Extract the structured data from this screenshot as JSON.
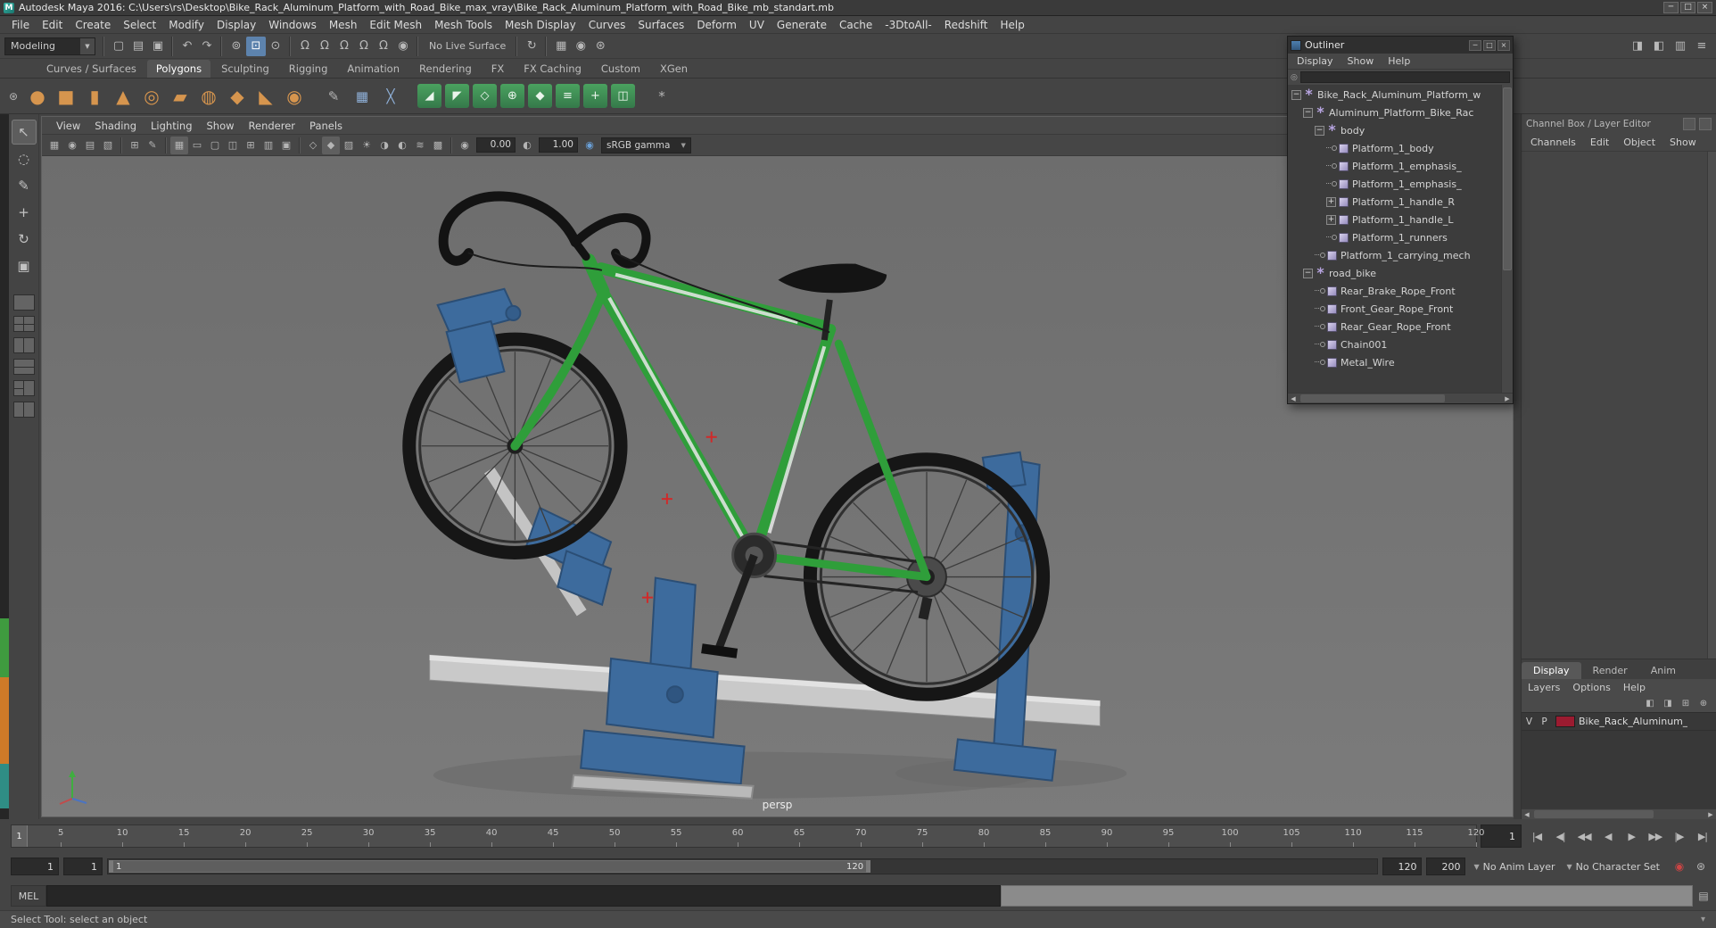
{
  "titlebar": {
    "title": "Autodesk Maya 2016: C:\\Users\\rs\\Desktop\\Bike_Rack_Aluminum_Platform_with_Road_Bike_max_vray\\Bike_Rack_Aluminum_Platform_with_Road_Bike_mb_standart.mb",
    "app_icon_letter": "M",
    "controls": [
      {
        "name": "minimize-button",
        "g": "─"
      },
      {
        "name": "maximize-button",
        "g": "□"
      },
      {
        "name": "close-button",
        "g": "×"
      }
    ]
  },
  "menubar": {
    "items": [
      "File",
      "Edit",
      "Create",
      "Select",
      "Modify",
      "Display",
      "Windows",
      "Mesh",
      "Edit Mesh",
      "Mesh Tools",
      "Mesh Display",
      "Curves",
      "Surfaces",
      "Deform",
      "UV",
      "Generate",
      "Cache",
      "-3DtoAll-",
      "Redshift",
      "Help"
    ]
  },
  "statusline": {
    "mode_selector": "Modeling",
    "items": [
      {
        "sep": true
      },
      {
        "icon": "new-scene-icon",
        "g": "▢"
      },
      {
        "icon": "open-scene-icon",
        "g": "▤"
      },
      {
        "icon": "save-scene-icon",
        "g": "▣"
      },
      {
        "sep": true
      },
      {
        "icon": "undo-icon",
        "g": "↶"
      },
      {
        "icon": "redo-icon",
        "g": "↷"
      },
      {
        "sep": true
      },
      {
        "icon": "select-by-hierarchy-icon",
        "g": "⊚"
      },
      {
        "icon": "select-by-object-icon",
        "g": "⊡",
        "active": true
      },
      {
        "icon": "select-by-component-icon",
        "g": "⊙"
      },
      {
        "sep": true
      },
      {
        "icon": "snap-to-grid-icon",
        "g": "Ω"
      },
      {
        "icon": "snap-to-curve-icon",
        "g": "Ω"
      },
      {
        "icon": "snap-to-point-icon",
        "g": "Ω"
      },
      {
        "icon": "snap-to-projected-center-icon",
        "g": "Ω"
      },
      {
        "icon": "snap-to-view-plane-icon",
        "g": "Ω"
      },
      {
        "icon": "make-live-icon",
        "g": "◉"
      },
      {
        "sep": true
      },
      {
        "label": "No Live Surface"
      },
      {
        "sep": true
      },
      {
        "icon": "construction-history-icon",
        "g": "↻"
      },
      {
        "sep": true
      },
      {
        "icon": "render-icon",
        "g": "▦"
      },
      {
        "icon": "ipr-render-icon",
        "g": "◉"
      },
      {
        "icon": "render-settings-icon",
        "g": "⊛"
      }
    ],
    "right_icons": [
      {
        "icon": "toggle-attribute-editor-icon",
        "g": "◨"
      },
      {
        "icon": "toggle-tool-settings-icon",
        "g": "◧"
      },
      {
        "icon": "toggle-channel-box-icon",
        "g": "▥"
      },
      {
        "icon": "workspace-icon",
        "g": "≡"
      }
    ]
  },
  "shelf": {
    "active_tab": "Polygons",
    "tabs": [
      "Curves / Surfaces",
      "Polygons",
      "Sculpting",
      "Rigging",
      "Animation",
      "Rendering",
      "FX",
      "FX Caching",
      "Custom",
      "XGen"
    ],
    "icons": [
      {
        "icon": "shelf-menu-icon",
        "g": "⊛",
        "style": "gray",
        "small": true
      },
      {
        "icon": "poly-sphere-icon",
        "g": "●",
        "style": "orange"
      },
      {
        "icon": "poly-cube-icon",
        "g": "■",
        "style": "orange"
      },
      {
        "icon": "poly-cylinder-icon",
        "g": "▮",
        "style": "orange"
      },
      {
        "icon": "poly-cone-icon",
        "g": "▲",
        "style": "orange"
      },
      {
        "icon": "poly-torus-icon",
        "g": "◎",
        "style": "orange"
      },
      {
        "icon": "poly-plane-icon",
        "g": "▰",
        "style": "orange"
      },
      {
        "icon": "poly-disc-icon",
        "g": "◍",
        "style": "orange"
      },
      {
        "icon": "poly-platonic-icon",
        "g": "◆",
        "style": "orange"
      },
      {
        "icon": "poly-pyramid-icon",
        "g": "◣",
        "style": "orange"
      },
      {
        "icon": "poly-helix-icon",
        "g": "◉",
        "style": "orange"
      },
      {
        "sep": true
      },
      {
        "icon": "pencil-curve-icon",
        "g": "✎",
        "style": "gray"
      },
      {
        "icon": "quad-draw-icon",
        "g": "▦",
        "style": "blue"
      },
      {
        "icon": "multi-cut-icon",
        "g": "╳",
        "style": "blue"
      },
      {
        "sep": true
      },
      {
        "icon": "combine-icon",
        "g": "◢",
        "style": "green"
      },
      {
        "icon": "separate-icon",
        "g": "◤",
        "style": "green"
      },
      {
        "icon": "smooth-icon",
        "g": "◇",
        "style": "green"
      },
      {
        "icon": "extrude-icon",
        "g": "⊕",
        "style": "green"
      },
      {
        "icon": "bevel-icon",
        "g": "◆",
        "style": "green"
      },
      {
        "icon": "bridge-icon",
        "g": "≡",
        "style": "green"
      },
      {
        "icon": "merge-icon",
        "g": "+",
        "style": "green"
      },
      {
        "icon": "mirror-icon",
        "g": "◫",
        "style": "green"
      },
      {
        "sep": true
      },
      {
        "icon": "sculpt-icon",
        "g": "*",
        "style": "gray"
      }
    ]
  },
  "toolbox": {
    "tools": [
      {
        "name": "select-tool",
        "g": "↖",
        "active": true
      },
      {
        "name": "lasso-tool",
        "g": "◌"
      },
      {
        "name": "paint-select-tool",
        "g": "✎"
      },
      {
        "name": "move-tool",
        "g": "+"
      },
      {
        "name": "rotate-tool",
        "g": "↻"
      },
      {
        "name": "scale-tool",
        "g": "▣"
      }
    ],
    "layouts": [
      {
        "name": "single-pane-layout",
        "pattern": "single"
      },
      {
        "name": "four-pane-layout",
        "pattern": "four"
      },
      {
        "name": "two-pane-side-layout",
        "pattern": "two-v"
      },
      {
        "name": "two-pane-stacked-layout",
        "pattern": "two-h"
      },
      {
        "name": "three-pane-layout",
        "pattern": "three"
      },
      {
        "name": "outliner-persp-layout",
        "pattern": "two-v"
      }
    ]
  },
  "viewport": {
    "menus": [
      "View",
      "Shading",
      "Lighting",
      "Show",
      "Renderer",
      "Panels"
    ],
    "items": [
      {
        "icon": "select-camera-icon",
        "g": "▦"
      },
      {
        "icon": "camera-attributes-icon",
        "g": "◉"
      },
      {
        "icon": "camera-bookmarks-icon",
        "g": "▤"
      },
      {
        "icon": "image-plane-icon",
        "g": "▧"
      },
      {
        "sep": true
      },
      {
        "icon": "2d-pan-zoom-icon",
        "g": "⊞"
      },
      {
        "icon": "grease-pencil-icon",
        "g": "✎"
      },
      {
        "sep": true
      },
      {
        "icon": "grid-icon",
        "g": "▦",
        "active": true
      },
      {
        "icon": "film-gate-icon",
        "g": "▭"
      },
      {
        "icon": "resolution-gate-icon",
        "g": "▢"
      },
      {
        "icon": "gate-mask-icon",
        "g": "◫"
      },
      {
        "icon": "field-chart-icon",
        "g": "⊞"
      },
      {
        "icon": "safe-action-icon",
        "g": "▥"
      },
      {
        "icon": "safe-title-icon",
        "g": "▣"
      },
      {
        "sep": true
      },
      {
        "icon": "wireframe-icon",
        "g": "◇"
      },
      {
        "icon": "smooth-shade-icon",
        "g": "◆",
        "active": true
      },
      {
        "icon": "textured-icon",
        "g": "▨"
      },
      {
        "icon": "use-all-lights-icon",
        "g": "☀"
      },
      {
        "icon": "shadows-icon",
        "g": "◑"
      },
      {
        "icon": "screen-space-ao-icon",
        "g": "◐"
      },
      {
        "icon": "motion-blur-icon",
        "g": "≋"
      },
      {
        "icon": "anti-alias-icon",
        "g": "▩"
      },
      {
        "sep": true
      },
      {
        "icon": "exposure-icon",
        "g": "◉"
      },
      {
        "field": "0.00",
        "name": "exposure-field"
      },
      {
        "icon": "gamma-icon",
        "g": "◐"
      },
      {
        "field": "1.00",
        "name": "gamma-field"
      },
      {
        "icon": "color-management-icon",
        "g": "◉",
        "color": "#6aa0d8"
      },
      {
        "dropdown": "sRGB gamma",
        "name": "view-transform-select"
      }
    ]
  },
  "scene": {
    "camera_label": "persp",
    "colors": {
      "viewport_top": "#6d6d6d",
      "viewport_bottom": "#7b7b7b",
      "bike_frame_green": "#2f9e3a",
      "bike_accent_white": "#e8e8e8",
      "rack_blue": "#3d6b9d",
      "rail_silver": "#c9c9c9",
      "tire_black": "#161616",
      "marker_red": "#d02a2a"
    }
  },
  "outliner": {
    "title": "Outliner",
    "menus": [
      "Display",
      "Show",
      "Help"
    ],
    "tree": [
      {
        "label": "Bike_Rack_Aluminum_Platform_w",
        "depth": 0,
        "icon": "star",
        "exp": "minus"
      },
      {
        "label": "Aluminum_Platform_Bike_Rac",
        "depth": 1,
        "icon": "star",
        "exp": "minus"
      },
      {
        "label": "body",
        "depth": 2,
        "icon": "star",
        "exp": "minus"
      },
      {
        "label": "Platform_1_body",
        "depth": 3,
        "icon": "mesh",
        "exp": "leaf"
      },
      {
        "label": "Platform_1_emphasis_",
        "depth": 3,
        "icon": "mesh",
        "exp": "leaf"
      },
      {
        "label": "Platform_1_emphasis_",
        "depth": 3,
        "icon": "mesh",
        "exp": "leaf"
      },
      {
        "label": "Platform_1_handle_R",
        "depth": 3,
        "icon": "mesh",
        "exp": "plus"
      },
      {
        "label": "Platform_1_handle_L",
        "depth": 3,
        "icon": "mesh",
        "exp": "plus"
      },
      {
        "label": "Platform_1_runners",
        "depth": 3,
        "icon": "mesh",
        "exp": "leaf"
      },
      {
        "label": "Platform_1_carrying_mech",
        "depth": 2,
        "icon": "mesh",
        "exp": "leaf"
      },
      {
        "label": "road_bike",
        "depth": 1,
        "icon": "star",
        "exp": "minus"
      },
      {
        "label": "Rear_Brake_Rope_Front",
        "depth": 2,
        "icon": "mesh",
        "exp": "leaf"
      },
      {
        "label": "Front_Gear_Rope_Front",
        "depth": 2,
        "icon": "mesh",
        "exp": "leaf"
      },
      {
        "label": "Rear_Gear_Rope_Front",
        "depth": 2,
        "icon": "mesh",
        "exp": "leaf"
      },
      {
        "label": "Chain001",
        "depth": 2,
        "icon": "mesh",
        "exp": "leaf"
      },
      {
        "label": "Metal_Wire",
        "depth": 2,
        "icon": "mesh",
        "exp": "leaf"
      }
    ]
  },
  "channelbox": {
    "header": "Channel Box / Layer Editor",
    "menus": [
      "Channels",
      "Edit",
      "Object",
      "Show"
    ]
  },
  "layer_editor": {
    "active_tab": "Display",
    "tabs": [
      "Display",
      "Render",
      "Anim"
    ],
    "menus": [
      "Layers",
      "Options",
      "Help"
    ],
    "icons": [
      {
        "icon": "layer-mode-icon",
        "g": "◧"
      },
      {
        "icon": "layer-visibility-icon",
        "g": "◨"
      },
      {
        "icon": "new-empty-layer-icon",
        "g": "⊞"
      },
      {
        "icon": "new-layer-from-selected-icon",
        "g": "⊕"
      }
    ],
    "layers": [
      {
        "visible": "V",
        "playback": "P",
        "color": "#9b1b30",
        "name": "Bike_Rack_Aluminum_"
      }
    ]
  },
  "timeline": {
    "playhead_frame": "1",
    "current_frame": "1",
    "ticks": [
      "5",
      "10",
      "15",
      "20",
      "25",
      "30",
      "35",
      "40",
      "45",
      "50",
      "55",
      "60",
      "65",
      "70",
      "75",
      "80",
      "85",
      "90",
      "95",
      "100",
      "105",
      "110",
      "115",
      "120"
    ]
  },
  "playback": {
    "buttons": [
      {
        "name": "go-to-start-button",
        "g": "|◀"
      },
      {
        "name": "step-back-frame-button",
        "g": "◀|"
      },
      {
        "name": "step-back-key-button",
        "g": "◀◀"
      },
      {
        "name": "play-backwards-button",
        "g": "◀"
      },
      {
        "name": "play-forwards-button",
        "g": "▶"
      },
      {
        "name": "step-forward-key-button",
        "g": "▶▶"
      },
      {
        "name": "step-forward-frame-button",
        "g": "|▶"
      },
      {
        "name": "go-to-end-button",
        "g": "▶|"
      }
    ]
  },
  "range": {
    "anim_start": "1",
    "play_start": "1",
    "bar_start_label": "1",
    "bar_end_label": "120",
    "play_end": "120",
    "anim_end": "200",
    "anim_layer": "No Anim Layer",
    "character_set": "No Character Set",
    "icons": [
      {
        "icon": "auto-keyframe-icon",
        "g": "◉",
        "autokey": true
      },
      {
        "icon": "animation-preferences-icon",
        "g": "⊛"
      }
    ]
  },
  "command_line": {
    "label": "MEL"
  },
  "help_line": {
    "text": "Select Tool: select an object",
    "toggle_glyph": "▾"
  }
}
